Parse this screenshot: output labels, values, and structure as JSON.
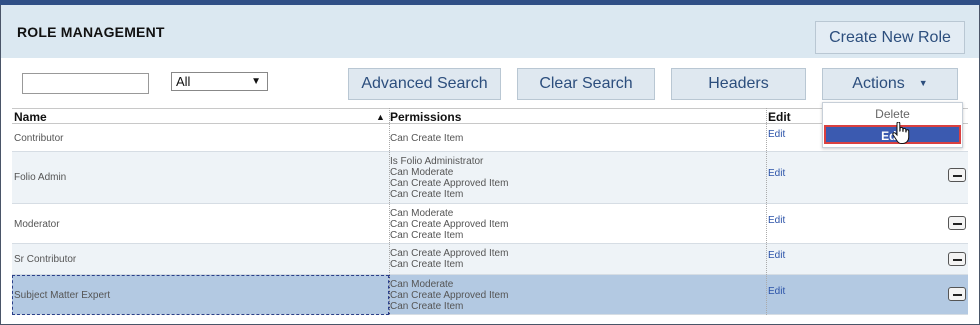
{
  "header": {
    "title": "ROLE MANAGEMENT",
    "create_button": "Create New Role"
  },
  "toolbar": {
    "search_value": "",
    "filter_selected": "All",
    "advanced_search": "Advanced Search",
    "clear_search": "Clear Search",
    "headers": "Headers",
    "actions": "Actions"
  },
  "actions_menu": {
    "delete": "Delete",
    "edit": "Edit"
  },
  "table": {
    "columns": [
      "Name",
      "Permissions",
      "Edit"
    ],
    "rows": [
      {
        "name": "Contributor",
        "permissions": [
          "Can Create Item"
        ],
        "edit": "Edit"
      },
      {
        "name": "Folio Admin",
        "permissions": [
          "Is Folio Administrator",
          "Can Moderate",
          "Can Create Approved Item",
          "Can Create Item"
        ],
        "edit": "Edit"
      },
      {
        "name": "Moderator",
        "permissions": [
          "Can Moderate",
          "Can Create Approved Item",
          "Can Create Item"
        ],
        "edit": "Edit"
      },
      {
        "name": "Sr Contributor",
        "permissions": [
          "Can Create Approved Item",
          "Can Create Item"
        ],
        "edit": "Edit"
      },
      {
        "name": "Subject Matter Expert",
        "permissions": [
          "Can Moderate",
          "Can Create Approved Item",
          "Can Create Item"
        ],
        "edit": "Edit"
      }
    ]
  },
  "colors": {
    "header_bg": "#dbe8f1",
    "topbar": "#2f4f86",
    "button_text": "#2c4e7d",
    "selected_row": "#b3c9e2",
    "menu_highlight": "#3b5ab0",
    "menu_outline": "#d94040"
  }
}
